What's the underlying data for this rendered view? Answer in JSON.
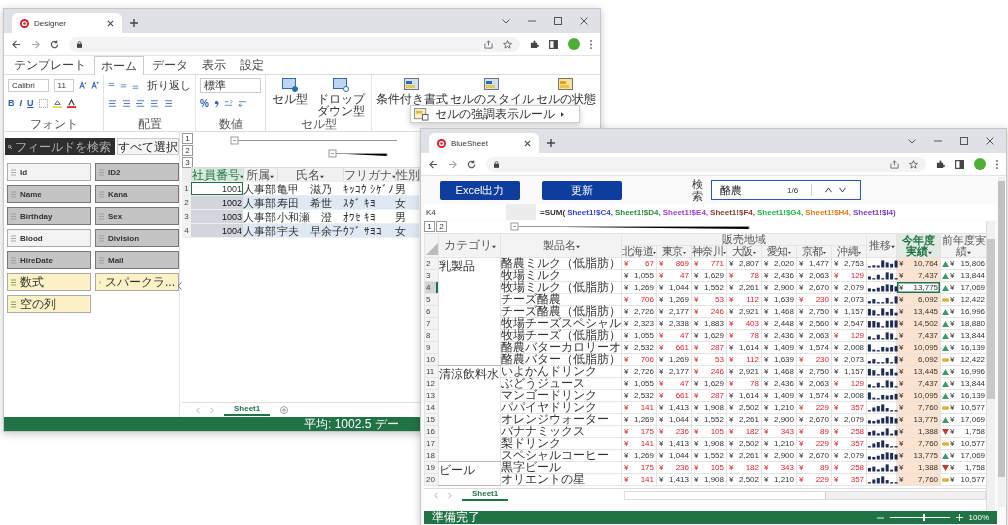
{
  "designer_window": {
    "tab_title": "Designer",
    "ribbon_tabs": [
      {
        "label": "テンプレート",
        "selected": false
      },
      {
        "label": "ホーム",
        "selected": true
      },
      {
        "label": "データ",
        "selected": false
      },
      {
        "label": "表示",
        "selected": false
      },
      {
        "label": "設定",
        "selected": false
      }
    ],
    "font_name": "Calibri",
    "font_size": "11",
    "font_style_buttons": [
      "B",
      "I",
      "U"
    ],
    "wrap_button": "折り返し",
    "number_format": "標準",
    "percent_button": "%",
    "group_labels": [
      "フォント",
      "配置",
      "数値",
      "セル型"
    ],
    "cell_type_buttons": [
      "セル型",
      "ドロップダウン型"
    ],
    "style_buttons": [
      "条件付き書式",
      "セルのスタイル",
      "セルの状態"
    ],
    "menu_item": "セルの強調表示ルール",
    "field_search_placeholder": "フィールドを検索",
    "select_all_button": "すべて選択",
    "fields": [
      {
        "label": "Id",
        "kind": "field",
        "selected": false
      },
      {
        "label": "ID2",
        "kind": "field",
        "selected": true
      },
      {
        "label": "Name",
        "kind": "field",
        "selected": true
      },
      {
        "label": "Kana",
        "kind": "field",
        "selected": true
      },
      {
        "label": "Birthday",
        "kind": "field",
        "selected": true
      },
      {
        "label": "Sex",
        "kind": "field",
        "selected": true
      },
      {
        "label": "Blood",
        "kind": "field",
        "selected": false
      },
      {
        "label": "Division",
        "kind": "field",
        "selected": true
      },
      {
        "label": "HireDate",
        "kind": "field",
        "selected": true
      },
      {
        "label": "Mail",
        "kind": "field",
        "selected": true
      },
      {
        "label": "数式",
        "kind": "formula",
        "selected": false
      },
      {
        "label": "スパークラ...",
        "kind": "formula",
        "selected": false
      },
      {
        "label": "空の列",
        "kind": "formula",
        "selected": false
      }
    ],
    "outline_levels": [
      "1",
      "2",
      "3"
    ],
    "sheet": {
      "columns": [
        {
          "label": "社員番号",
          "selected": true
        },
        {
          "label": "所属",
          "selected": false
        },
        {
          "label": "氏名",
          "selected": false
        },
        {
          "label": "フリガナ",
          "selected": false
        },
        {
          "label": "性別",
          "selected": false
        }
      ],
      "rows": [
        {
          "number": "1",
          "cells": [
            "1001",
            "人事部",
            "亀甲　滋乃",
            "ｷｯｺｳ ｼｹﾞﾉ",
            "男"
          ]
        },
        {
          "number": "2",
          "cells": [
            "1002",
            "人事部",
            "寿田　希世",
            "ｽﾀﾞ ｷﾖ",
            "女"
          ]
        },
        {
          "number": "3",
          "cells": [
            "1003",
            "人事部",
            "小和瀬　澄",
            "ｵﾜｾ ｷﾖ",
            "男"
          ]
        },
        {
          "number": "4",
          "cells": [
            "1004",
            "人事部",
            "宇夫　早余子",
            "ｳﾌﾞ ｻﾖｺ",
            "女"
          ]
        }
      ]
    },
    "sheet_tab": "Sheet1",
    "status": "平均: 1002.5 デー"
  },
  "sheet_window": {
    "tab_title": "BlueSheet",
    "buttons": [
      "Excel出力",
      "更新"
    ],
    "search_label": "検索",
    "search_value": "酪農",
    "search_count": "1/6",
    "name_box": "K4",
    "formula": [
      {
        "text": "=SUM(",
        "color": "#333333"
      },
      {
        "text": "Sheet1!$C4,",
        "color": "#3043d0"
      },
      {
        "text": "Sheet1!$D4,",
        "color": "#2a8a3a"
      },
      {
        "text": "Sheet1!$E4,",
        "color": "#a23cc8"
      },
      {
        "text": "Sheet1!$F4,",
        "color": "#8b3a2a"
      },
      {
        "text": "Sheet1!$G4,",
        "color": "#22b04a"
      },
      {
        "text": "Sheet1!$H4,",
        "color": "#e07b14"
      },
      {
        "text": "Sheet1!$I4)",
        "color": "#7a3cc8"
      }
    ],
    "outline_levels": [
      "1",
      "2"
    ],
    "columns": {
      "category": "カテゴリ",
      "product": "製品名",
      "region_group": "販売地域",
      "regions": [
        "北海道",
        "東京",
        "神奈川",
        "大阪",
        "愛知",
        "京都",
        "沖縄"
      ],
      "trend": "推移",
      "current": "今年度実績",
      "previous": "前年度実績"
    },
    "rows": [
      {
        "number": "2",
        "category": "乳製品",
        "product": "酪農ミルク（低脂肪）",
        "regions": [
          {
            "v": "¥ 67",
            "low": true
          },
          {
            "v": "¥ 869",
            "low": true
          },
          {
            "v": "¥ 771",
            "low": true
          },
          {
            "v": "¥ 2,807",
            "low": false
          },
          {
            "v": "¥ 2,020",
            "low": false
          },
          {
            "v": "¥ 1,477",
            "low": false
          },
          {
            "v": "¥ 2,753",
            "low": false
          }
        ],
        "current": "¥ 10,764",
        "kind": "up",
        "previous": "¥ 15,806",
        "selected": false
      },
      {
        "number": "3",
        "product": "牧場ミルク",
        "regions": [
          {
            "v": "¥ 1,055",
            "low": false
          },
          {
            "v": "¥ 47",
            "low": true
          },
          {
            "v": "¥ 1,629",
            "low": false
          },
          {
            "v": "¥ 78",
            "low": true
          },
          {
            "v": "¥ 2,436",
            "low": false
          },
          {
            "v": "¥ 2,063",
            "low": false
          },
          {
            "v": "¥ 129",
            "low": true
          }
        ],
        "current": "¥ 7,437",
        "kind": "up",
        "previous": "¥ 13,844",
        "selected": false
      },
      {
        "number": "4",
        "product": "牧場ミルク（低脂肪）",
        "regions": [
          {
            "v": "¥ 1,269",
            "low": false
          },
          {
            "v": "¥ 1,044",
            "low": false
          },
          {
            "v": "¥ 1,552",
            "low": false
          },
          {
            "v": "¥ 2,261",
            "low": false
          },
          {
            "v": "¥ 2,900",
            "low": false
          },
          {
            "v": "¥ 2,670",
            "low": false
          },
          {
            "v": "¥ 2,079",
            "low": false
          }
        ],
        "current": "¥ 13,775",
        "kind": "up",
        "previous": "¥ 17,069",
        "selected": true
      },
      {
        "number": "5",
        "product": "チーズ酪農",
        "regions": [
          {
            "v": "¥ 706",
            "low": true
          },
          {
            "v": "¥ 1,269",
            "low": false
          },
          {
            "v": "¥ 53",
            "low": true
          },
          {
            "v": "¥ 112",
            "low": true
          },
          {
            "v": "¥ 1,639",
            "low": false
          },
          {
            "v": "¥ 230",
            "low": true
          },
          {
            "v": "¥ 2,073",
            "low": false
          }
        ],
        "current": "¥ 6,092",
        "kind": "flat",
        "previous": "¥ 12,422",
        "selected": false
      },
      {
        "number": "6",
        "product": "チーズ酪農（低脂肪）",
        "regions": [
          {
            "v": "¥ 2,726",
            "low": false
          },
          {
            "v": "¥ 2,177",
            "low": false
          },
          {
            "v": "¥ 246",
            "low": true
          },
          {
            "v": "¥ 2,921",
            "low": false
          },
          {
            "v": "¥ 1,468",
            "low": false
          },
          {
            "v": "¥ 2,750",
            "low": false
          },
          {
            "v": "¥ 1,157",
            "low": false
          }
        ],
        "current": "¥ 13,445",
        "kind": "up",
        "previous": "¥ 16,996",
        "selected": false
      },
      {
        "number": "7",
        "product": "牧場チーズスペシャル",
        "regions": [
          {
            "v": "¥ 2,323",
            "low": false
          },
          {
            "v": "¥ 2,338",
            "low": false
          },
          {
            "v": "¥ 1,883",
            "low": false
          },
          {
            "v": "¥ 403",
            "low": true
          },
          {
            "v": "¥ 2,448",
            "low": false
          },
          {
            "v": "¥ 2,560",
            "low": false
          },
          {
            "v": "¥ 2,547",
            "low": false
          }
        ],
        "current": "¥ 14,502",
        "kind": "up",
        "previous": "¥ 18,880",
        "selected": false
      },
      {
        "number": "8",
        "product": "牧場チーズ（低脂肪）",
        "regions": [
          {
            "v": "¥ 1,055",
            "low": false
          },
          {
            "v": "¥ 47",
            "low": true
          },
          {
            "v": "¥ 1,629",
            "low": false
          },
          {
            "v": "¥ 78",
            "low": true
          },
          {
            "v": "¥ 2,436",
            "low": false
          },
          {
            "v": "¥ 2,063",
            "low": false
          },
          {
            "v": "¥ 129",
            "low": true
          }
        ],
        "current": "¥ 7,437",
        "kind": "up",
        "previous": "¥ 13,844",
        "selected": false
      },
      {
        "number": "9",
        "product": "酪農バターカロリーオ",
        "regions": [
          {
            "v": "¥ 2,532",
            "low": false
          },
          {
            "v": "¥ 661",
            "low": true
          },
          {
            "v": "¥ 287",
            "low": true
          },
          {
            "v": "¥ 1,614",
            "low": false
          },
          {
            "v": "¥ 1,409",
            "low": false
          },
          {
            "v": "¥ 1,574",
            "low": false
          },
          {
            "v": "¥ 2,008",
            "low": false
          }
        ],
        "current": "¥ 10,095",
        "kind": "up",
        "previous": "¥ 16,139",
        "selected": false
      },
      {
        "number": "10",
        "product": "酪農バター（低脂肪）",
        "regions": [
          {
            "v": "¥ 706",
            "low": true
          },
          {
            "v": "¥ 1,269",
            "low": false
          },
          {
            "v": "¥ 53",
            "low": true
          },
          {
            "v": "¥ 112",
            "low": true
          },
          {
            "v": "¥ 1,639",
            "low": false
          },
          {
            "v": "¥ 230",
            "low": true
          },
          {
            "v": "¥ 2,073",
            "low": false
          }
        ],
        "current": "¥ 6,092",
        "kind": "flat",
        "previous": "¥ 12,422",
        "selected": false
      },
      {
        "number": "11",
        "category": "清涼飲料水",
        "product": "いよかんドリンク",
        "regions": [
          {
            "v": "¥ 2,726",
            "low": false
          },
          {
            "v": "¥ 2,177",
            "low": false
          },
          {
            "v": "¥ 246",
            "low": true
          },
          {
            "v": "¥ 2,921",
            "low": false
          },
          {
            "v": "¥ 1,468",
            "low": false
          },
          {
            "v": "¥ 2,750",
            "low": false
          },
          {
            "v": "¥ 1,157",
            "low": false
          }
        ],
        "current": "¥ 13,445",
        "kind": "up",
        "previous": "¥ 16,996",
        "selected": false
      },
      {
        "number": "12",
        "product": "ぶどうジュース",
        "regions": [
          {
            "v": "¥ 1,055",
            "low": false
          },
          {
            "v": "¥ 47",
            "low": true
          },
          {
            "v": "¥ 1,629",
            "low": false
          },
          {
            "v": "¥ 78",
            "low": true
          },
          {
            "v": "¥ 2,436",
            "low": false
          },
          {
            "v": "¥ 2,063",
            "low": false
          },
          {
            "v": "¥ 129",
            "low": true
          }
        ],
        "current": "¥ 7,437",
        "kind": "up",
        "previous": "¥ 13,844",
        "selected": false
      },
      {
        "number": "13",
        "product": "マンゴードリンク",
        "regions": [
          {
            "v": "¥ 2,532",
            "low": false
          },
          {
            "v": "¥ 661",
            "low": true
          },
          {
            "v": "¥ 287",
            "low": true
          },
          {
            "v": "¥ 1,614",
            "low": false
          },
          {
            "v": "¥ 1,409",
            "low": false
          },
          {
            "v": "¥ 1,574",
            "low": false
          },
          {
            "v": "¥ 2,008",
            "low": false
          }
        ],
        "current": "¥ 10,095",
        "kind": "up",
        "previous": "¥ 16,139",
        "selected": false
      },
      {
        "number": "14",
        "product": "パパイヤドリンク",
        "regions": [
          {
            "v": "¥ 141",
            "low": true
          },
          {
            "v": "¥ 1,413",
            "low": false
          },
          {
            "v": "¥ 1,908",
            "low": false
          },
          {
            "v": "¥ 2,502",
            "low": false
          },
          {
            "v": "¥ 1,210",
            "low": false
          },
          {
            "v": "¥ 229",
            "low": true
          },
          {
            "v": "¥ 357",
            "low": true
          }
        ],
        "current": "¥ 7,760",
        "kind": "flat",
        "previous": "¥ 10,577",
        "selected": false
      },
      {
        "number": "15",
        "product": "オレンジウォーター",
        "regions": [
          {
            "v": "¥ 1,269",
            "low": false
          },
          {
            "v": "¥ 1,044",
            "low": false
          },
          {
            "v": "¥ 1,552",
            "low": false
          },
          {
            "v": "¥ 2,261",
            "low": false
          },
          {
            "v": "¥ 2,900",
            "low": false
          },
          {
            "v": "¥ 2,670",
            "low": false
          },
          {
            "v": "¥ 2,079",
            "low": false
          }
        ],
        "current": "¥ 13,775",
        "kind": "up",
        "previous": "¥ 17,069",
        "selected": false
      },
      {
        "number": "16",
        "product": "バナナミックス",
        "regions": [
          {
            "v": "¥ 175",
            "low": true
          },
          {
            "v": "¥ 236",
            "low": true
          },
          {
            "v": "¥ 105",
            "low": true
          },
          {
            "v": "¥ 182",
            "low": true
          },
          {
            "v": "¥ 343",
            "low": true
          },
          {
            "v": "¥ 89",
            "low": true
          },
          {
            "v": "¥ 258",
            "low": true
          }
        ],
        "current": "¥ 1,388",
        "kind": "down",
        "previous": "¥ 1,758",
        "selected": false
      },
      {
        "number": "17",
        "product": "梨ドリンク",
        "regions": [
          {
            "v": "¥ 141",
            "low": true
          },
          {
            "v": "¥ 1,413",
            "low": false
          },
          {
            "v": "¥ 1,908",
            "low": false
          },
          {
            "v": "¥ 2,502",
            "low": false
          },
          {
            "v": "¥ 1,210",
            "low": false
          },
          {
            "v": "¥ 229",
            "low": true
          },
          {
            "v": "¥ 357",
            "low": true
          }
        ],
        "current": "¥ 7,760",
        "kind": "flat",
        "previous": "¥ 10,577",
        "selected": false
      },
      {
        "number": "18",
        "product": "スペシャルコーヒー",
        "regions": [
          {
            "v": "¥ 1,269",
            "low": false
          },
          {
            "v": "¥ 1,044",
            "low": false
          },
          {
            "v": "¥ 1,552",
            "low": false
          },
          {
            "v": "¥ 2,261",
            "low": false
          },
          {
            "v": "¥ 2,900",
            "low": false
          },
          {
            "v": "¥ 2,670",
            "low": false
          },
          {
            "v": "¥ 2,079",
            "low": false
          }
        ],
        "current": "¥ 13,775",
        "kind": "up",
        "previous": "¥ 17,069",
        "selected": false
      },
      {
        "number": "19",
        "category": "ビール",
        "product": "黒字ビール",
        "regions": [
          {
            "v": "¥ 175",
            "low": true
          },
          {
            "v": "¥ 236",
            "low": true
          },
          {
            "v": "¥ 105",
            "low": true
          },
          {
            "v": "¥ 182",
            "low": true
          },
          {
            "v": "¥ 343",
            "low": true
          },
          {
            "v": "¥ 89",
            "low": true
          },
          {
            "v": "¥ 258",
            "low": true
          }
        ],
        "current": "¥ 1,388",
        "kind": "down",
        "previous": "¥ 1,758",
        "selected": false
      },
      {
        "number": "20",
        "product": "オリエントの星",
        "regions": [
          {
            "v": "¥ 141",
            "low": true
          },
          {
            "v": "¥ 1,413",
            "low": false
          },
          {
            "v": "¥ 1,908",
            "low": false
          },
          {
            "v": "¥ 2,502",
            "low": false
          },
          {
            "v": "¥ 1,210",
            "low": false
          },
          {
            "v": "¥ 229",
            "low": true
          },
          {
            "v": "¥ 357",
            "low": true
          }
        ],
        "current": "¥ 7,760",
        "kind": "flat",
        "previous": "¥ 10,577",
        "selected": false
      }
    ],
    "sheet_tab": "Sheet1",
    "status": "準備完了",
    "zoom": {
      "label": "100%",
      "level": 0.55
    }
  }
}
